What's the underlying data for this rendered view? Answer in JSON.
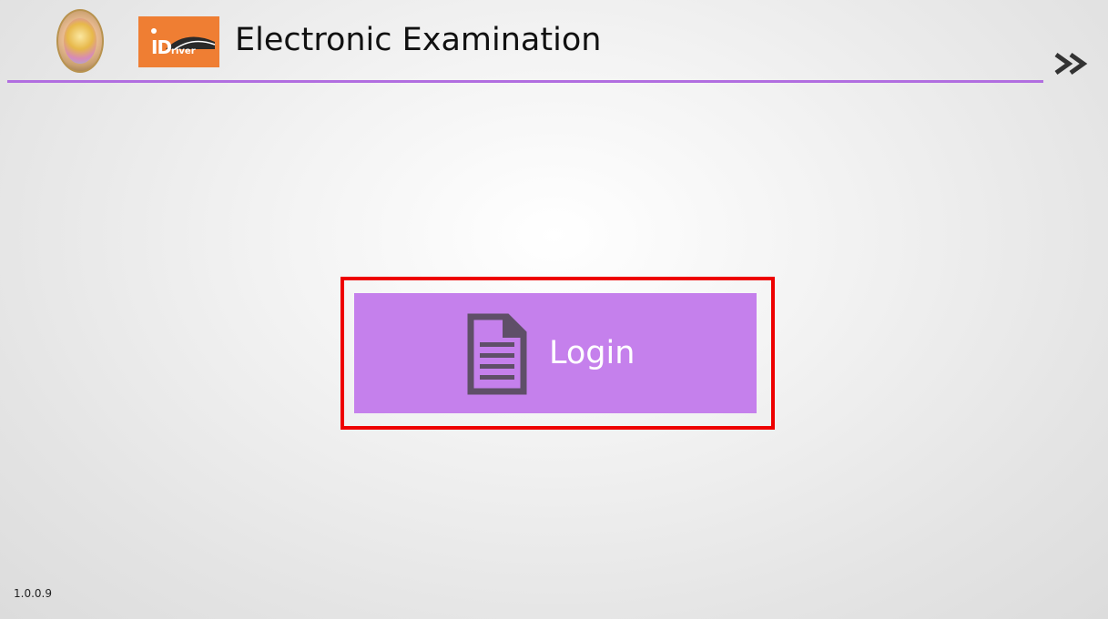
{
  "header": {
    "seal_logo": "emblem-seal",
    "brand_logo_text": "iDriver",
    "title": "Electronic Examination",
    "next_icon": "double-chevron-right-icon",
    "accent_color": "#b16ee0"
  },
  "main": {
    "login_button": {
      "label": "Login",
      "icon": "document-icon",
      "background": "#c580ec",
      "highlight_color": "#ee0000"
    }
  },
  "footer": {
    "version": "1.0.0.9"
  }
}
